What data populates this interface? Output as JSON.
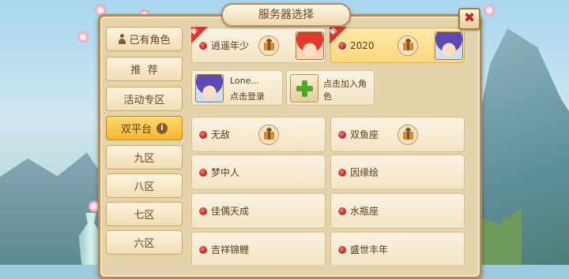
{
  "title": "服务器选择",
  "close_label": "✖",
  "sidebar": {
    "items": [
      {
        "label": "已有角色",
        "icon": "person-icon",
        "active": false
      },
      {
        "label": "推  荐",
        "active": false
      },
      {
        "label": "活动专区",
        "active": false
      },
      {
        "label": "双平台",
        "icon": "info-icon",
        "info": "i",
        "active": true
      },
      {
        "label": "九区",
        "active": false
      },
      {
        "label": "八区",
        "active": false
      },
      {
        "label": "七区",
        "active": false
      },
      {
        "label": "六区",
        "active": false
      }
    ]
  },
  "recent": [
    {
      "name": "逍遥年少",
      "new_badge": "新",
      "gift": true,
      "avatar": "red-hair-avatar",
      "selected": false
    },
    {
      "name": "2020",
      "new_badge": "新",
      "gift": true,
      "avatar": "purple-hair-avatar",
      "selected": true
    }
  ],
  "roles": {
    "existing": {
      "name": "Lone...",
      "action": "点击登录",
      "avatar": "purple-hair-avatar"
    },
    "add": {
      "label": "点击加入角色"
    }
  },
  "servers": [
    {
      "name": "无敌",
      "gift": true
    },
    {
      "name": "双鱼座",
      "gift": true
    },
    {
      "name": "梦中人",
      "gift": false
    },
    {
      "name": "因缘绘",
      "gift": false
    },
    {
      "name": "佳偶天成",
      "gift": false
    },
    {
      "name": "水瓶座",
      "gift": false
    },
    {
      "name": "吉祥锦鲤",
      "gift": false
    },
    {
      "name": "盛世丰年",
      "gift": false
    }
  ],
  "colors": {
    "status_dot": "#c21a10",
    "active_tab": "#f2b630",
    "add_icon": "#4fa82a"
  }
}
